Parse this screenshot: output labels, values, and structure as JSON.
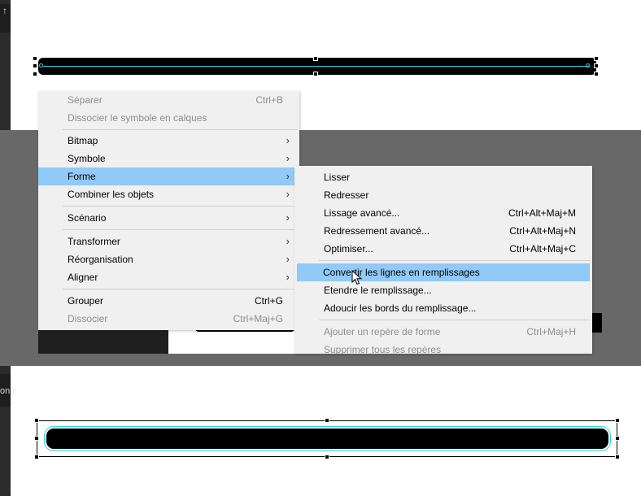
{
  "left_panel": {
    "label": "on"
  },
  "context_menu": {
    "items": [
      {
        "label": "Séparer",
        "shortcut": "Ctrl+B",
        "disabled": true
      },
      {
        "label": "Dissocier le symbole en calques",
        "shortcut": "",
        "disabled": true
      },
      {
        "label": "Bitmap",
        "submenu": true
      },
      {
        "label": "Symbole",
        "submenu": true
      },
      {
        "label": "Forme",
        "submenu": true,
        "highlighted": true
      },
      {
        "label": "Combiner les objets",
        "submenu": true
      },
      {
        "label": "Scénario",
        "submenu": true
      },
      {
        "label": "Transformer",
        "submenu": true
      },
      {
        "label": "Réorganisation",
        "submenu": true
      },
      {
        "label": "Aligner",
        "submenu": true
      },
      {
        "label": "Grouper",
        "shortcut": "Ctrl+G"
      },
      {
        "label": "Dissocier",
        "shortcut": "Ctrl+Maj+G",
        "disabled": true
      }
    ]
  },
  "forme_submenu": {
    "items": [
      {
        "label": "Lisser",
        "shortcut": ""
      },
      {
        "label": "Redresser",
        "shortcut": ""
      },
      {
        "label": "Lissage avancé...",
        "shortcut": "Ctrl+Alt+Maj+M"
      },
      {
        "label": "Redressement avancé...",
        "shortcut": "Ctrl+Alt+Maj+N"
      },
      {
        "label": "Optimiser...",
        "shortcut": "Ctrl+Alt+Maj+C"
      },
      {
        "label": "Convertir les lignes en remplissages",
        "shortcut": "",
        "highlighted": true
      },
      {
        "label": "Etendre le remplissage...",
        "shortcut": ""
      },
      {
        "label": "Adoucir les bords du remplissage...",
        "shortcut": ""
      },
      {
        "label": "Ajouter un repère de forme",
        "shortcut": "Ctrl+Maj+H",
        "disabled": true
      },
      {
        "label": "Supprimer tous les repères",
        "shortcut": "",
        "disabled": true
      }
    ]
  },
  "icons": {
    "submenu_arrow": "chevron-right-icon",
    "panel_arrow": "arrow-up-icon"
  },
  "colors": {
    "highlight": "#91c9f7",
    "selection_path": "#27d7e8",
    "overlay": "#686868"
  }
}
